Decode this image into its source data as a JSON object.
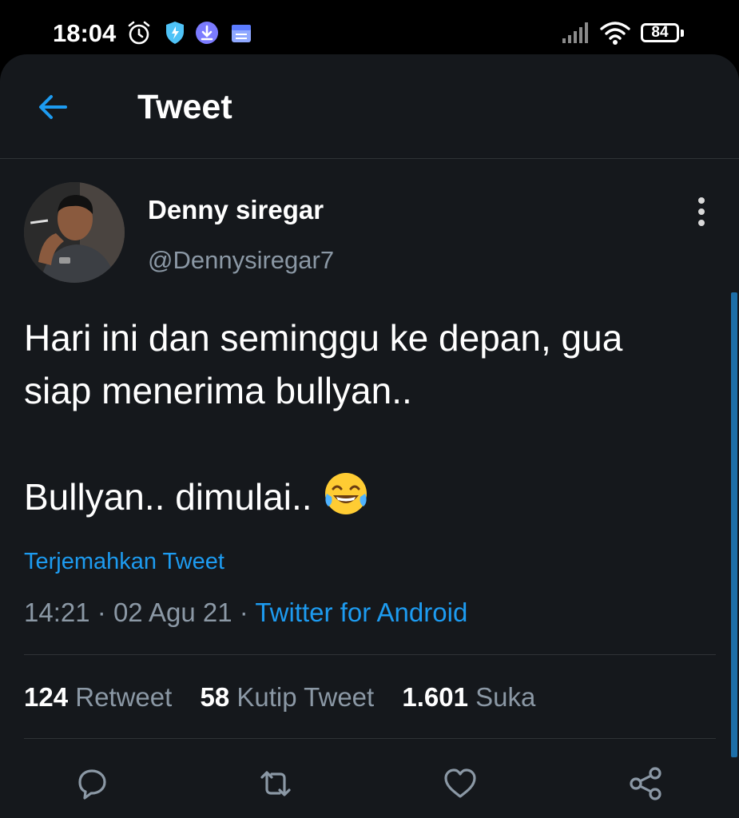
{
  "status_bar": {
    "time": "18:04",
    "icons": [
      "alarm-icon",
      "shield-icon",
      "download-icon",
      "calendar-icon",
      "signal-icon",
      "wifi-icon"
    ],
    "battery": "84"
  },
  "header": {
    "title": "Tweet",
    "back_icon": "back-arrow-icon"
  },
  "tweet": {
    "author_name": "Denny siregar",
    "author_handle": "@Dennysiregar7",
    "text_line1": "Hari ini dan seminggu ke depan, gua",
    "text_line2": "siap menerima bullyan..",
    "text_line3": "Bullyan.. dimulai..",
    "emoji": "face-with-tears-of-joy",
    "translate_label": "Terjemahkan Tweet",
    "time": "14:21",
    "separator": "·",
    "date": "02 Agu 21",
    "source": "Twitter for Android"
  },
  "stats": {
    "retweets_count": "124",
    "retweets_label": "Retweet",
    "quotes_count": "58",
    "quotes_label": "Kutip Tweet",
    "likes_count": "1.601",
    "likes_label": "Suka"
  },
  "actions": [
    "reply-icon",
    "retweet-icon",
    "like-icon",
    "share-icon"
  ],
  "colors": {
    "background": "#15181c",
    "accent": "#1d9bf0",
    "secondary_text": "#8b98a5",
    "divider": "#2f3336"
  }
}
